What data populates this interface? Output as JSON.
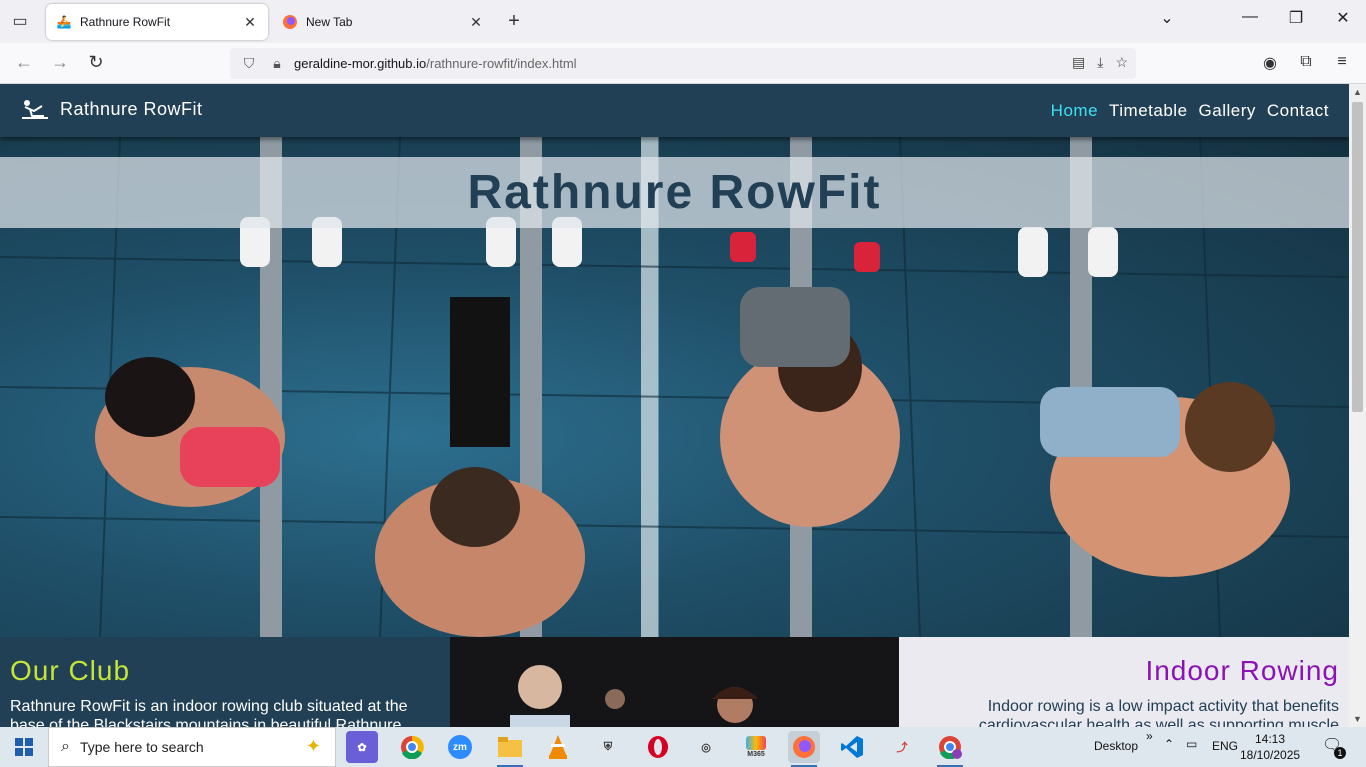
{
  "browser": {
    "tabs": [
      {
        "title": "Rathnure RowFit",
        "active": true
      },
      {
        "title": "New Tab",
        "active": false
      }
    ],
    "url_domain": "geraldine-mor.github.io",
    "url_path": "/rathnure-rowfit/index.html"
  },
  "site": {
    "logo_text": "Rathnure RowFit",
    "nav": [
      {
        "label": "Home",
        "active": true
      },
      {
        "label": "Timetable",
        "active": false
      },
      {
        "label": "Gallery",
        "active": false
      },
      {
        "label": "Contact",
        "active": false
      }
    ],
    "hero_title": "Rathnure RowFit",
    "club": {
      "heading": "Our Club",
      "text": "Rathnure RowFit is an indoor rowing club situated at the base of the Blackstairs mountains in beautiful Rathnure"
    },
    "rowing": {
      "heading": "Indoor Rowing",
      "text": "Indoor rowing is a low impact activity that benefits cardiovascular health as well as supporting muscle"
    },
    "colors": {
      "header_bg": "#213f55",
      "nav_active": "#3fe0f4",
      "club_heading": "#c5e43a",
      "rowing_heading": "#8a13b5"
    }
  },
  "taskbar": {
    "search_placeholder": "Type here to search",
    "desktop_label": "Desktop",
    "language": "ENG",
    "time": "14:13",
    "date": "18/10/2025",
    "notification_count": "1",
    "m365_label": "M365",
    "zoom_label": "zm"
  }
}
